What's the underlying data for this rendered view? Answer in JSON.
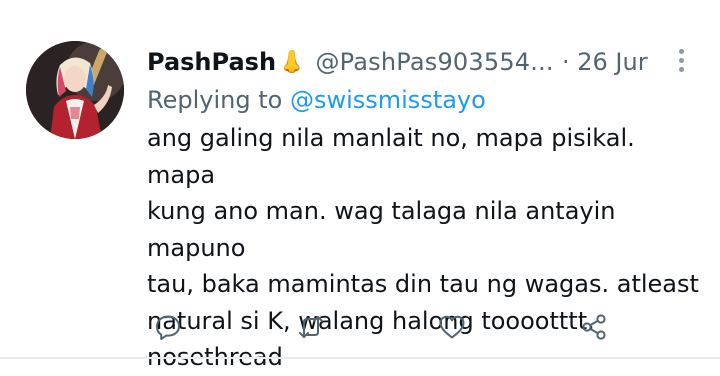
{
  "tweet": {
    "display_name": "PashPash",
    "display_name_emoji": "👃",
    "handle": "@PashPas903554...",
    "date": "· 26 Jur",
    "replying_prefix": "Replying to",
    "replying_mention": "@swissmisstayo",
    "body_lines": [
      "ang galing nila manlait no, mapa pisikal. mapa",
      "kung ano man. wag talaga nila antayin mapuno",
      "tau, baka mamintas din tau ng wagas. atleast",
      "natural si K, walang halong tooootttt.",
      "nosethread"
    ]
  },
  "actions": [
    {
      "name": "reply-button",
      "icon": "reply-icon"
    },
    {
      "name": "retweet-button",
      "icon": "retweet-icon"
    },
    {
      "name": "like-button",
      "icon": "heart-icon"
    },
    {
      "name": "share-button",
      "icon": "share-icon"
    }
  ],
  "colors": {
    "text": "#0f1419",
    "muted": "#536471",
    "link": "#1d9bf0",
    "background": "#ffffff"
  }
}
